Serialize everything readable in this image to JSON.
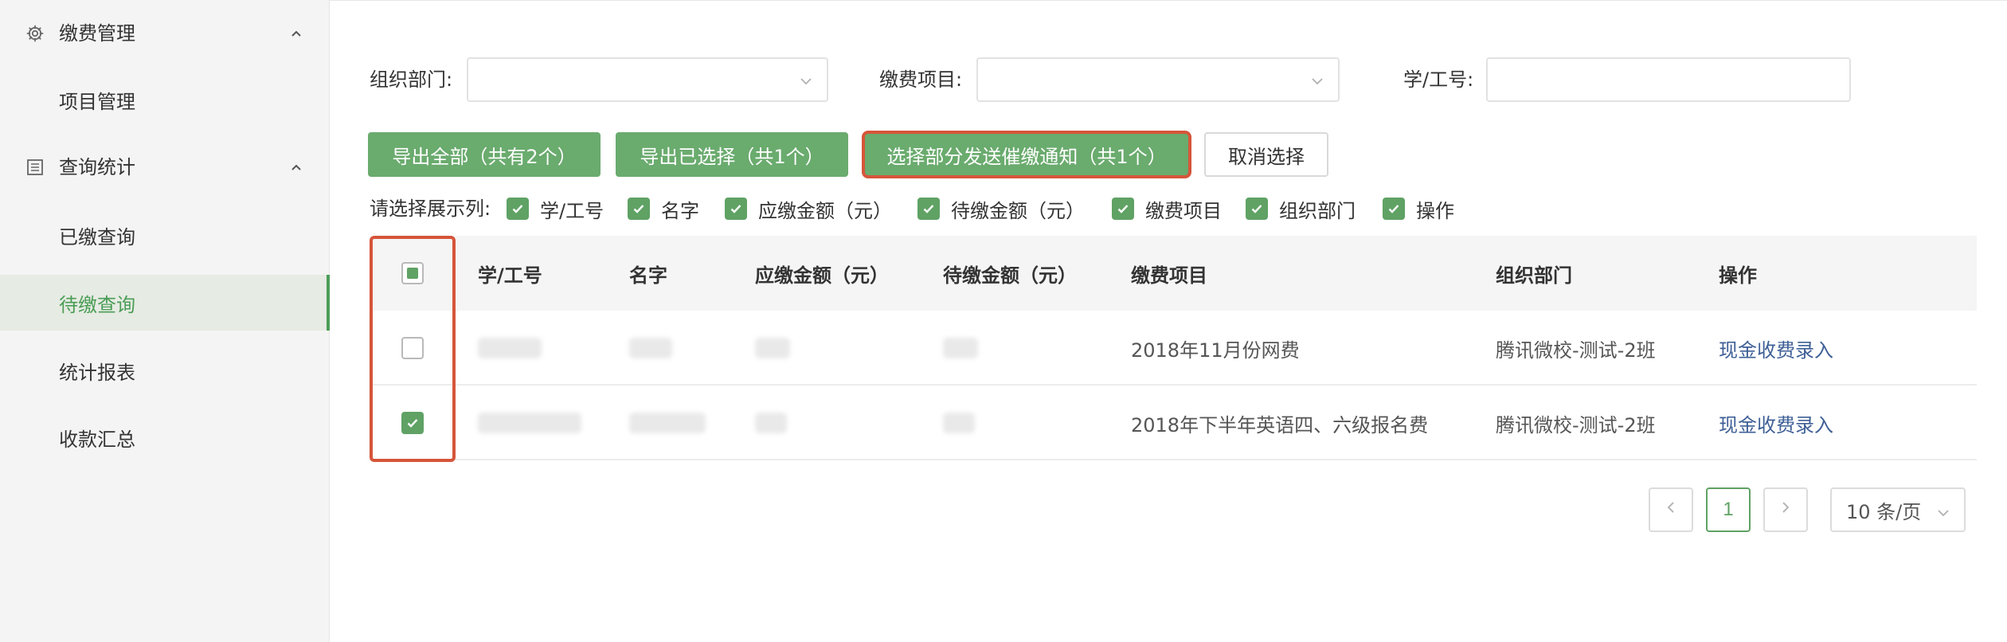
{
  "sidebar": {
    "groups": [
      {
        "label": "缴费管理",
        "icon": "gear-icon",
        "expanded": true
      },
      {
        "label": "查询统计",
        "icon": "list-icon",
        "expanded": true
      }
    ],
    "items": [
      {
        "label": "项目管理",
        "active": false
      },
      {
        "label": "已缴查询",
        "active": false
      },
      {
        "label": "待缴查询",
        "active": true
      },
      {
        "label": "统计报表",
        "active": false
      },
      {
        "label": "收款汇总",
        "active": false
      }
    ]
  },
  "filters": {
    "dept_label": "组织部门:",
    "dept_value": "",
    "item_label": "缴费项目:",
    "item_value": "",
    "id_label": "学/工号:",
    "id_value": ""
  },
  "actions": {
    "export_all": "导出全部（共有2个）",
    "export_selected": "导出已选择（共1个）",
    "send_notice": "选择部分发送催缴通知（共1个）",
    "cancel_select": "取消选择"
  },
  "columns_chooser": {
    "label": "请选择展示列:",
    "options": [
      "学/工号",
      "名字",
      "应缴金额（元）",
      "待缴金额（元）",
      "缴费项目",
      "组织部门",
      "操作"
    ]
  },
  "table": {
    "headers": [
      "学/工号",
      "名字",
      "应缴金额（元）",
      "待缴金额（元）",
      "缴费项目",
      "组织部门",
      "操作"
    ],
    "rows": [
      {
        "checked": false,
        "id": "",
        "name": "",
        "due": "",
        "pending": "",
        "item": "2018年11月份网费",
        "dept": "腾讯微校-测试-2班",
        "action": "现金收费录入"
      },
      {
        "checked": true,
        "id": "",
        "name": "",
        "due": "",
        "pending": "",
        "item": "2018年下半年英语四、六级报名费",
        "dept": "腾讯微校-测试-2班",
        "action": "现金收费录入"
      }
    ]
  },
  "pagination": {
    "prev": "<",
    "page": "1",
    "next": ">",
    "page_size": "10 条/页"
  },
  "colors": {
    "accent": "#6aab6e",
    "highlight": "#d6553a",
    "link": "#3e5f96"
  }
}
